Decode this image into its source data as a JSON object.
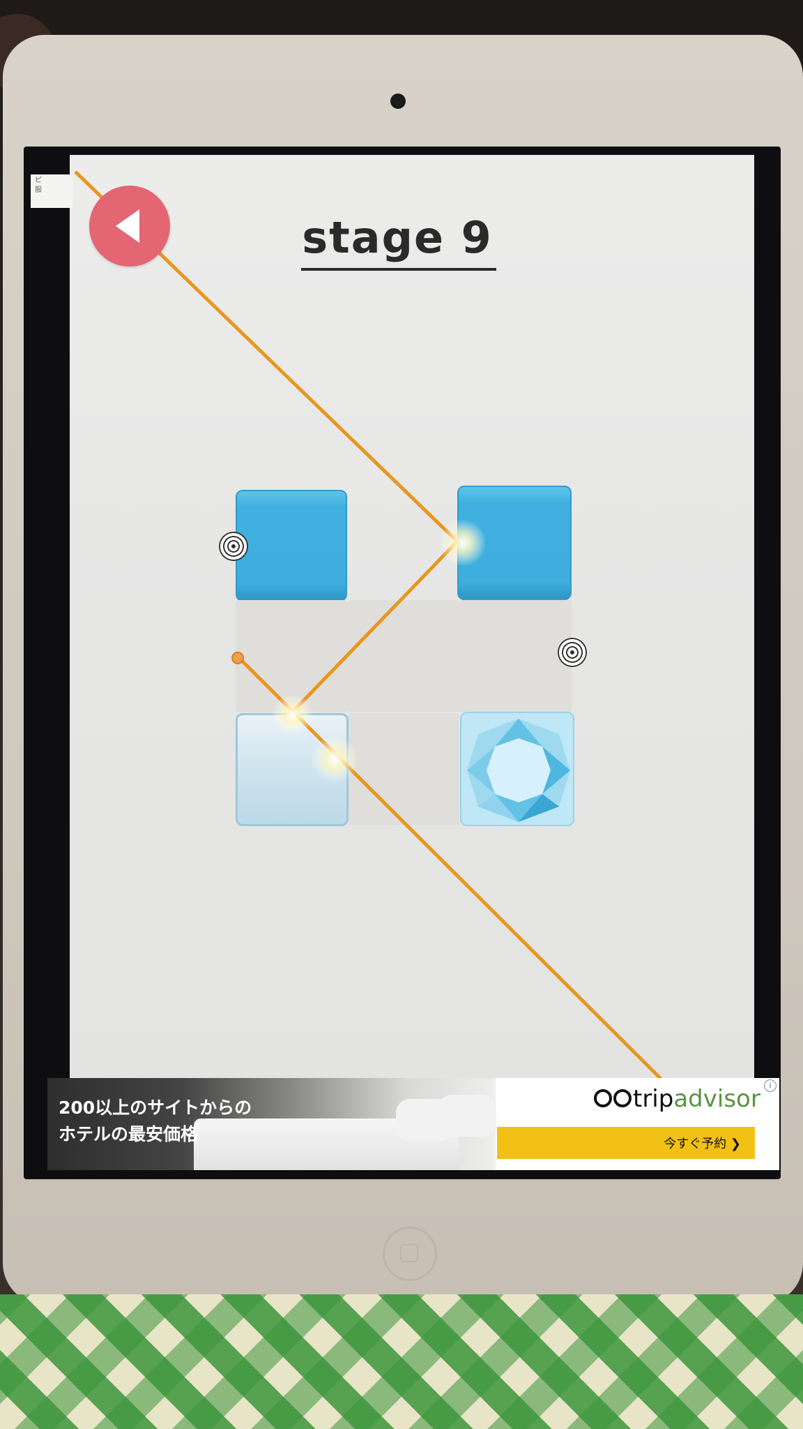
{
  "game": {
    "title": "stage  9",
    "back_button": "back-arrow-icon",
    "corner_tab": [
      "ピ",
      "服"
    ]
  },
  "board": {
    "rows": 3,
    "cols": 3,
    "tiles": [
      [
        "blue",
        "none",
        "blue"
      ],
      [
        "empty",
        "empty",
        "empty"
      ],
      [
        "glass",
        "empty",
        "gem"
      ]
    ],
    "targets": [
      "target-left-row1",
      "target-right-row2"
    ]
  },
  "ad": {
    "headline_line1": "200以上のサイトからの",
    "headline_line2": "ホテルの最安価格",
    "brand_trip": "trip",
    "brand_advisor": "advisor",
    "cta_label": "今すぐ予約",
    "info_icon": "i"
  },
  "colors": {
    "laser": "#e8961e",
    "tile_blue": "#3fb0df",
    "back_button": "#e46672"
  }
}
